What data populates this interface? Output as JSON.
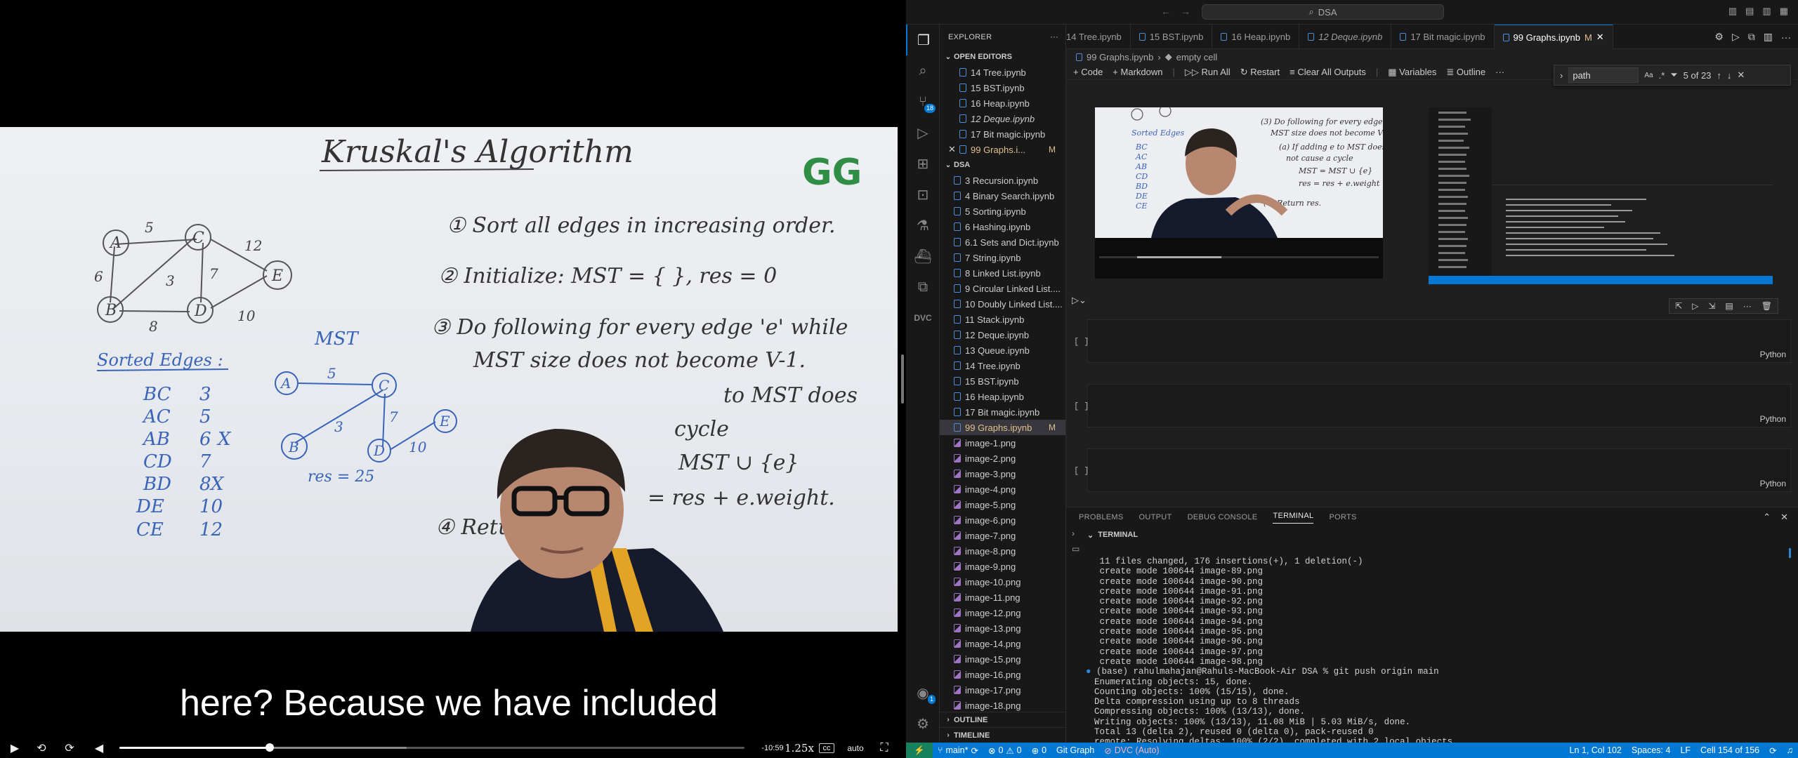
{
  "player": {
    "caption": "here? Because we have included",
    "time_remaining": "-10:59",
    "speed": "1.25x",
    "quality": "auto",
    "progress": 0.24,
    "buffered": 0.46,
    "icons": [
      "play-icon",
      "rewind-10-icon",
      "forward-10-icon",
      "volume-icon",
      "cc-icon",
      "fullscreen-icon"
    ]
  },
  "whiteboard": {
    "title": "Kruskal's Algorithm",
    "logo": "GG",
    "graph_labels": [
      "A",
      "B",
      "C",
      "D",
      "E"
    ],
    "edge_weights": [
      "5",
      "12",
      "6",
      "3",
      "7",
      "8",
      "10"
    ],
    "sorted_edges_title": "Sorted Edges :",
    "sorted_edges": [
      {
        "edge": "BC",
        "w": "3",
        "mark": ""
      },
      {
        "edge": "AC",
        "w": "5",
        "mark": ""
      },
      {
        "edge": "AB",
        "w": "6",
        "mark": "X"
      },
      {
        "edge": "CD",
        "w": "7",
        "mark": ""
      },
      {
        "edge": "BD",
        "w": "8",
        "mark": "X"
      },
      {
        "edge": "DE",
        "w": "10",
        "mark": ""
      },
      {
        "edge": "CE",
        "w": "12",
        "mark": ""
      }
    ],
    "mst_title": "MST",
    "mst_weights": [
      "5",
      "3",
      "7",
      "10"
    ],
    "mst_res": "res = 25",
    "steps": [
      "① Sort all edges in increasing order.",
      "② Initialize: MST = { }, res = 0",
      "③ Do following for every edge 'e' while",
      "MST size does not become V-1.",
      "to MST does",
      "cycle",
      "MST ∪ {e}",
      "= res + e.weight.",
      "④ Retu"
    ]
  },
  "vscode": {
    "search": "DSA",
    "explorer_title": "EXPLORER",
    "open_editors_title": "OPEN EDITORS",
    "open_editors": [
      {
        "name": "14 Tree.ipynb",
        "italic": false,
        "mod": ""
      },
      {
        "name": "15 BST.ipynb",
        "italic": false,
        "mod": ""
      },
      {
        "name": "16 Heap.ipynb",
        "italic": false,
        "mod": ""
      },
      {
        "name": "12 Deque.ipynb",
        "italic": true,
        "mod": ""
      },
      {
        "name": "17 Bit magic.ipynb",
        "italic": false,
        "mod": ""
      },
      {
        "name": "99 Graphs.i...",
        "italic": false,
        "mod": "M"
      }
    ],
    "folder_title": "DSA",
    "files": [
      {
        "name": "3 Recursion.ipynb",
        "type": "nb",
        "mod": ""
      },
      {
        "name": "4 Binary Search.ipynb",
        "type": "nb",
        "mod": ""
      },
      {
        "name": "5 Sorting.ipynb",
        "type": "nb",
        "mod": ""
      },
      {
        "name": "6 Hashing.ipynb",
        "type": "nb",
        "mod": ""
      },
      {
        "name": "6.1 Sets and Dict.ipynb",
        "type": "nb",
        "mod": ""
      },
      {
        "name": "7 String.ipynb",
        "type": "nb",
        "mod": ""
      },
      {
        "name": "8 Linked List.ipynb",
        "type": "nb",
        "mod": ""
      },
      {
        "name": "9 Circular Linked List....",
        "type": "nb",
        "mod": ""
      },
      {
        "name": "10 Doubly Linked List....",
        "type": "nb",
        "mod": ""
      },
      {
        "name": "11 Stack.ipynb",
        "type": "nb",
        "mod": ""
      },
      {
        "name": "12 Deque.ipynb",
        "type": "nb",
        "mod": ""
      },
      {
        "name": "13 Queue.ipynb",
        "type": "nb",
        "mod": ""
      },
      {
        "name": "14 Tree.ipynb",
        "type": "nb",
        "mod": ""
      },
      {
        "name": "15 BST.ipynb",
        "type": "nb",
        "mod": ""
      },
      {
        "name": "16 Heap.ipynb",
        "type": "nb",
        "mod": ""
      },
      {
        "name": "17 Bit magic.ipynb",
        "type": "nb",
        "mod": ""
      },
      {
        "name": "99 Graphs.ipynb",
        "type": "nb",
        "mod": "M"
      },
      {
        "name": "image-1.png",
        "type": "img",
        "mod": ""
      },
      {
        "name": "image-2.png",
        "type": "img",
        "mod": ""
      },
      {
        "name": "image-3.png",
        "type": "img",
        "mod": ""
      },
      {
        "name": "image-4.png",
        "type": "img",
        "mod": ""
      },
      {
        "name": "image-5.png",
        "type": "img",
        "mod": ""
      },
      {
        "name": "image-6.png",
        "type": "img",
        "mod": ""
      },
      {
        "name": "image-7.png",
        "type": "img",
        "mod": ""
      },
      {
        "name": "image-8.png",
        "type": "img",
        "mod": ""
      },
      {
        "name": "image-9.png",
        "type": "img",
        "mod": ""
      },
      {
        "name": "image-10.png",
        "type": "img",
        "mod": ""
      },
      {
        "name": "image-11.png",
        "type": "img",
        "mod": ""
      },
      {
        "name": "image-12.png",
        "type": "img",
        "mod": ""
      },
      {
        "name": "image-13.png",
        "type": "img",
        "mod": ""
      },
      {
        "name": "image-14.png",
        "type": "img",
        "mod": ""
      },
      {
        "name": "image-15.png",
        "type": "img",
        "mod": ""
      },
      {
        "name": "image-16.png",
        "type": "img",
        "mod": ""
      },
      {
        "name": "image-17.png",
        "type": "img",
        "mod": ""
      },
      {
        "name": "image-18.png",
        "type": "img",
        "mod": ""
      }
    ],
    "outline_title": "OUTLINE",
    "timeline_title": "TIMELINE",
    "tabs": [
      {
        "name": "14 Tree.ipynb",
        "italic": false,
        "mod": ""
      },
      {
        "name": "15 BST.ipynb",
        "italic": false,
        "mod": ""
      },
      {
        "name": "16 Heap.ipynb",
        "italic": false,
        "mod": ""
      },
      {
        "name": "12 Deque.ipynb",
        "italic": true,
        "mod": ""
      },
      {
        "name": "17 Bit magic.ipynb",
        "italic": false,
        "mod": ""
      },
      {
        "name": "99 Graphs.ipynb",
        "italic": false,
        "mod": "M",
        "active": true
      }
    ],
    "breadcrumb": {
      "file": "99 Graphs.ipynb",
      "cell": "empty cell"
    },
    "toolbar": {
      "code": "Code",
      "markdown": "Markdown",
      "run_all": "Run All",
      "restart": "Restart",
      "clear": "Clear All Outputs",
      "variables": "Variables",
      "outline": "Outline"
    },
    "find": {
      "value": "path",
      "count": "5 of 23"
    },
    "cells": [
      {
        "bracket": "[ ]",
        "lang": "Python"
      },
      {
        "bracket": "[ ]",
        "lang": "Python"
      },
      {
        "bracket": "[ ]",
        "lang": "Python"
      }
    ],
    "panel_tabs": [
      "PROBLEMS",
      "OUTPUT",
      "DEBUG CONSOLE",
      "TERMINAL",
      "PORTS"
    ],
    "terminal_title": "TERMINAL",
    "terminal_lines": [
      " 11 files changed, 176 insertions(+), 1 deletion(-)",
      " create mode 100644 image-89.png",
      " create mode 100644 image-90.png",
      " create mode 100644 image-91.png",
      " create mode 100644 image-92.png",
      " create mode 100644 image-93.png",
      " create mode 100644 image-94.png",
      " create mode 100644 image-95.png",
      " create mode 100644 image-96.png",
      " create mode 100644 image-97.png",
      " create mode 100644 image-98.png",
      "(base) rahulmahajan@Rahuls-MacBook-Air DSA % git push origin main",
      "Enumerating objects: 15, done.",
      "Counting objects: 100% (15/15), done.",
      "Delta compression using up to 8 threads",
      "Compressing objects: 100% (13/13), done.",
      "Writing objects: 100% (13/13), 11.08 MiB | 5.03 MiB/s, done.",
      "Total 13 (delta 2), reused 0 (delta 0), pack-reused 0",
      "remote: Resolving deltas: 100% (2/2), completed with 2 local objects."
    ],
    "status": {
      "branch": "main*",
      "errors": "0",
      "warnings": "0",
      "ports": "0",
      "git_graph": "Git Graph",
      "dvc": "DVC (Auto)",
      "position": "Ln 1, Col 102",
      "spaces": "Spaces: 4",
      "eol": "LF",
      "cell": "Cell 154 of 156"
    },
    "badges": {
      "scm": "18",
      "accounts": "1"
    }
  }
}
